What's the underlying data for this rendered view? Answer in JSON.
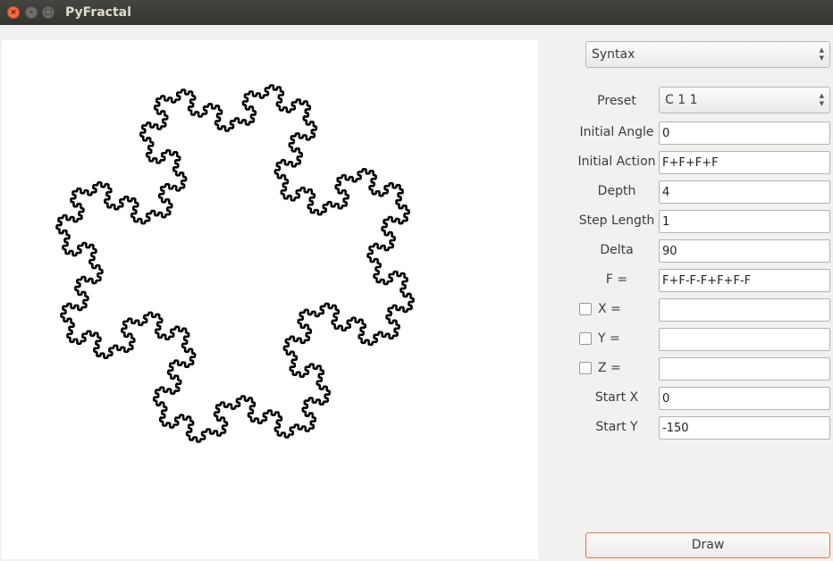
{
  "window": {
    "title": "PyFractal"
  },
  "mode_select": {
    "value": "Syntax"
  },
  "form": {
    "preset_label": "Preset",
    "preset_value": "C 1 1",
    "initial_angle_label": "Initial Angle",
    "initial_angle_value": "0",
    "initial_action_label": "Initial Action",
    "initial_action_value": "F+F+F+F",
    "depth_label": "Depth",
    "depth_value": "4",
    "step_length_label": "Step Length",
    "step_length_value": "1",
    "delta_label": "Delta",
    "delta_value": "90",
    "f_label": "F =",
    "f_value": "F+F-F-F+F+F-F",
    "x_label": "X =",
    "x_value": "",
    "x_checked": false,
    "y_label": "Y =",
    "y_value": "",
    "y_checked": false,
    "z_label": "Z =",
    "z_value": "",
    "z_checked": false,
    "start_x_label": "Start X",
    "start_x_value": "0",
    "start_y_label": "Start Y",
    "start_y_value": "-150"
  },
  "draw_button": {
    "label": "Draw"
  },
  "colors": {
    "accent": "#e3734b",
    "stroke": "#000000",
    "canvas": "#ffffff"
  }
}
